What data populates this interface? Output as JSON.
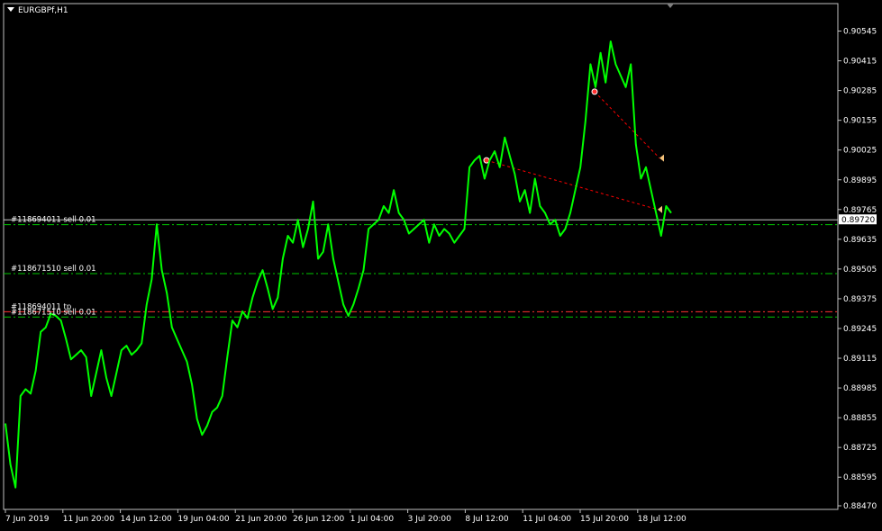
{
  "window": {
    "title": "EURGBPf,H1",
    "colors": {
      "background": "#000000",
      "price_line": "#00FF00",
      "axis": "#FFFFFF",
      "order_line": "#00C800",
      "tp_line": "#FF3030",
      "current_price_bg": "#FFFFFF",
      "trade_line": "#FF0000"
    }
  },
  "chart_data": {
    "type": "line",
    "symbol": "EURGBPf",
    "timeframe": "H1",
    "ylim": [
      0.8847,
      0.9061
    ],
    "y_ticks": [
      "0.90545",
      "0.90415",
      "0.90285",
      "0.90155",
      "0.90025",
      "0.89895",
      "0.89765",
      "0.89635",
      "0.89505",
      "0.89375",
      "0.89245",
      "0.89115",
      "0.88985",
      "0.88855",
      "0.88725",
      "0.88595",
      "0.88470"
    ],
    "x_ticks": [
      "7 Jun 2019",
      "11 Jun 20:00",
      "14 Jun 12:00",
      "19 Jun 04:00",
      "21 Jun 20:00",
      "26 Jun 12:00",
      "1 Jul 04:00",
      "3 Jul 20:00",
      "8 Jul 12:00",
      "11 Jul 04:00",
      "15 Jul 20:00",
      "18 Jul 12:00"
    ],
    "current_price": "0.89720",
    "series": [
      {
        "values": [
          0.8883,
          0.8865,
          0.8855,
          0.8895,
          0.8898,
          0.8896,
          0.8906,
          0.8923,
          0.8925,
          0.8931,
          0.893,
          0.8928,
          0.892,
          0.8911,
          0.8913,
          0.8915,
          0.8912,
          0.8895,
          0.8905,
          0.8915,
          0.8903,
          0.8895,
          0.8905,
          0.8915,
          0.8917,
          0.8913,
          0.8915,
          0.8918,
          0.8935,
          0.8946,
          0.897,
          0.895,
          0.894,
          0.8925,
          0.892,
          0.8915,
          0.891,
          0.89,
          0.8885,
          0.8878,
          0.8882,
          0.8888,
          0.889,
          0.8895,
          0.8912,
          0.8928,
          0.8925,
          0.8932,
          0.8929,
          0.8938,
          0.8945,
          0.895,
          0.8942,
          0.8933,
          0.8938,
          0.8955,
          0.8965,
          0.8962,
          0.8972,
          0.896,
          0.8968,
          0.898,
          0.8955,
          0.8958,
          0.897,
          0.8955,
          0.8945,
          0.8935,
          0.893,
          0.8935,
          0.8942,
          0.895,
          0.8968,
          0.897,
          0.8972,
          0.8978,
          0.8975,
          0.8985,
          0.8975,
          0.8972,
          0.8966,
          0.8968,
          0.897,
          0.8972,
          0.8962,
          0.897,
          0.8965,
          0.8968,
          0.8966,
          0.8962,
          0.8965,
          0.8968,
          0.8995,
          0.8998,
          0.9,
          0.899,
          0.8998,
          0.9002,
          0.8995,
          0.9008,
          0.9,
          0.8992,
          0.898,
          0.8985,
          0.8975,
          0.899,
          0.8978,
          0.8975,
          0.897,
          0.8972,
          0.8965,
          0.8968,
          0.8975,
          0.8985,
          0.8995,
          0.9015,
          0.904,
          0.903,
          0.9045,
          0.9032,
          0.905,
          0.904,
          0.9035,
          0.903,
          0.904,
          0.9005,
          0.899,
          0.8995,
          0.8985,
          0.8975,
          0.8965,
          0.8978,
          0.8975
        ]
      }
    ],
    "order_labels": [
      {
        "text": "#118694011 sell 0.01",
        "price": 0.89699
      },
      {
        "text": "#118671510 sell 0.01",
        "price": 0.89485
      },
      {
        "text": "#118694011 tp",
        "price": 0.89318
      },
      {
        "text": "#118671510 sell 0.01",
        "price": 0.89295
      }
    ],
    "trades": [
      {
        "open_price": 0.8998,
        "close_price": 0.89765
      },
      {
        "open_price": 0.9028,
        "close_price": 0.8999
      }
    ]
  }
}
